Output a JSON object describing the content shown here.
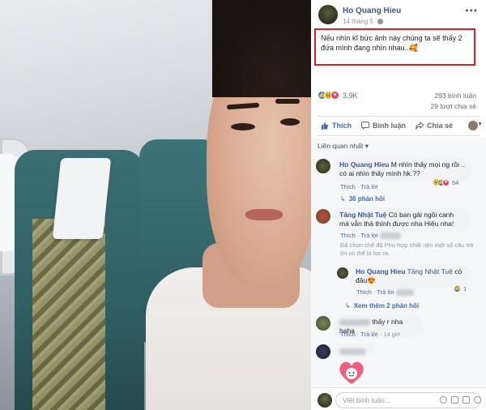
{
  "post": {
    "author": "Ho Quang Hieu",
    "date": "14 tháng 5",
    "caption": "Nếu nhìn kĩ bức ảnh này chúng ta sẽ thấy 2 đứa mình đang nhìn nhau..🥰",
    "more": "•••"
  },
  "engagement": {
    "reaction_count": "3,9K",
    "comments": "293 bình luận",
    "shares": "29 lượt chia sẻ"
  },
  "actions": {
    "like": "Thích",
    "comment": "Bình luận",
    "share": "Chia sẻ"
  },
  "comments": {
    "sort": "Liên quan nhất ▾",
    "c1": {
      "name": "Ho Quang Hieu",
      "text": "M nhìn thấy mọi ng rồi .. có ai nhìn thấy mình hk.??",
      "like": "Thích",
      "reply": "Trả lời",
      "react_count": "54",
      "replies": "36 phản hồi"
    },
    "c2": {
      "name": "Tăng Nhật Tuệ",
      "text": "Có ban gái ngồi canh má vẫn thả thính được nha Hiếu nha!",
      "like": "Thích",
      "reply": "Trả lời",
      "notice": "Đã chọn chế độ Phù hợp nhất nên một số câu trả lời có thể bị lọc ra.",
      "r1": {
        "name": "Ho Quang Hieu",
        "tag": "Tăng Nhật Tuệ",
        "text": "có đâu😍",
        "like": "Thích",
        "reply": "Trả lời",
        "react_count": "1"
      },
      "more_replies": "Xem thêm 2 phản hồi"
    },
    "c3": {
      "text": "thấy r nha haha",
      "like": "Thích",
      "reply": "Trả lời",
      "time": "14 giờ"
    }
  },
  "composer": {
    "placeholder": "Viết bình luận..."
  }
}
